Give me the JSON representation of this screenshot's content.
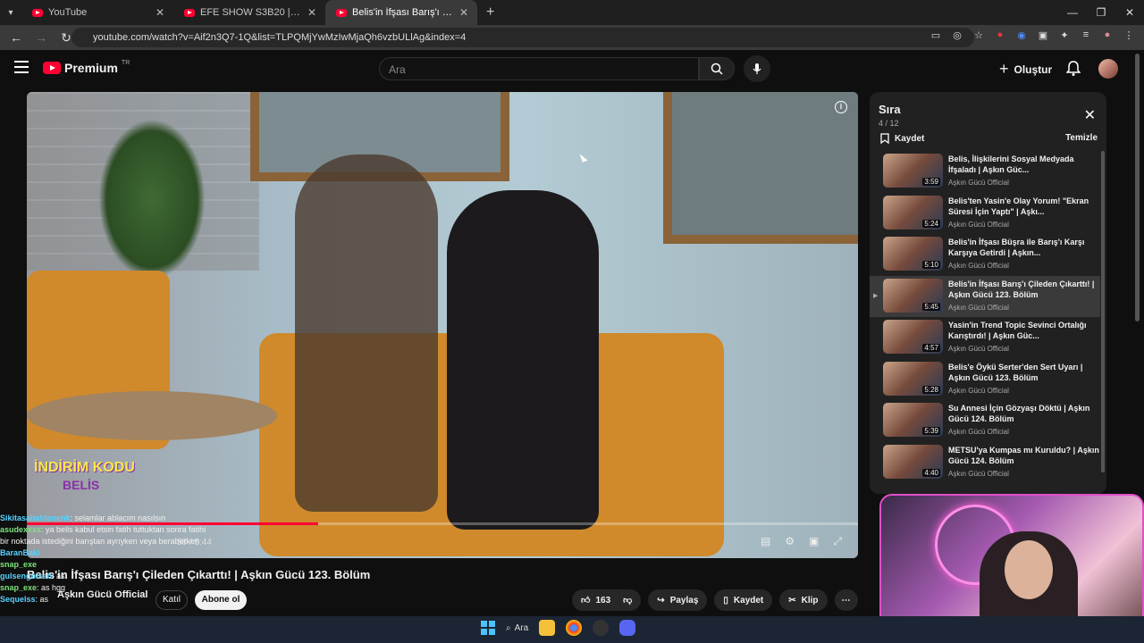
{
  "browser": {
    "tabs": [
      {
        "label": "YouTube",
        "active": false
      },
      {
        "label": "EFE SHOW S3B20 | ERAY CAN Ç",
        "active": false
      },
      {
        "label": "Belis'in İfşası Barış'ı Çileden Çı",
        "active": true
      }
    ],
    "url": "youtube.com/watch?v=Aif2n3Q7-1Q&list=TLPQMjYwMzIwMjaQh6vzbULlAg&index=4"
  },
  "header": {
    "logo_text": "Premium",
    "logo_sup": "TR",
    "search_placeholder": "Ara",
    "create_label": "Oluştur"
  },
  "video": {
    "time": "58 / 5:44",
    "progress": 0.35,
    "overlay_line1": "İNDİRİM KODU",
    "overlay_line2": "BELİS",
    "title": "Belis'in İfşası Barış'ı Çileden Çıkarttı! | Aşkın Gücü 123. Bölüm",
    "channel": "Aşkın Gücü Official",
    "join_label": "Katıl",
    "subscribe_label": "Abone ol",
    "likes": "163",
    "share_label": "Paylaş",
    "save_label": "Kaydet",
    "clip_label": "Klip"
  },
  "queue": {
    "title": "Sıra",
    "count": "4 / 12",
    "save_label": "Kaydet",
    "clear_label": "Temizle",
    "items": [
      {
        "title": "Belis, İlişkilerini Sosyal Medyada İfşaladı | Aşkın Güc...",
        "channel": "Aşkın Gücü Official",
        "duration": "3:59"
      },
      {
        "title": "Belis'ten Yasin'e Olay Yorum! \"Ekran Süresi İçin Yaptı\" | Aşkı...",
        "channel": "Aşkın Gücü Official",
        "duration": "5:24"
      },
      {
        "title": "Belis'in İfşası Büşra ile Barış'ı Karşı Karşıya Getirdi | Aşkın...",
        "channel": "Aşkın Gücü Official",
        "duration": "5:10"
      },
      {
        "title": "Belis'in İfşası Barış'ı Çileden Çıkarttı! | Aşkın Gücü 123. Bölüm",
        "channel": "Aşkın Gücü Official",
        "duration": "5:45"
      },
      {
        "title": "Yasin'in Trend Topic Sevinci Ortalığı Karıştırdı! | Aşkın Güc...",
        "channel": "Aşkın Gücü Official",
        "duration": "4:57"
      },
      {
        "title": "Belis'e Öykü Serter'den Sert Uyarı | Aşkın Gücü 123. Bölüm",
        "channel": "Aşkın Gücü Official",
        "duration": "5:28"
      },
      {
        "title": "Su Annesi İçin Gözyaşı Döktü | Aşkın Gücü 124. Bölüm",
        "channel": "Aşkın Gücü Official",
        "duration": "5:39"
      },
      {
        "title": "METSU'ya Kumpas mı Kuruldu? | Aşkın Gücü 124. Bölüm",
        "channel": "Aşkın Gücü Official",
        "duration": "4:40"
      }
    ],
    "current_index": 3
  },
  "chat": [
    {
      "user": "Sikitasabaldanenk",
      "text": ": selamlar ablacım nasılsın"
    },
    {
      "user": "asudexxxx",
      "text": ": ya belis kabul etsin fatih tuttuktan sonra fatihi bir noktada istediğini barıştan ayrıyken veya beraberken"
    },
    {
      "user": "BaranBaki",
      "text": ""
    },
    {
      "user": "snap_exe",
      "text": ""
    },
    {
      "user": "gulsengulsah",
      "text": ": as"
    },
    {
      "user": "snap_exe",
      "text": ": as hgg"
    },
    {
      "user": "Sequelss",
      "text": ": as"
    }
  ],
  "taskbar": {
    "search_label": "Ara"
  }
}
